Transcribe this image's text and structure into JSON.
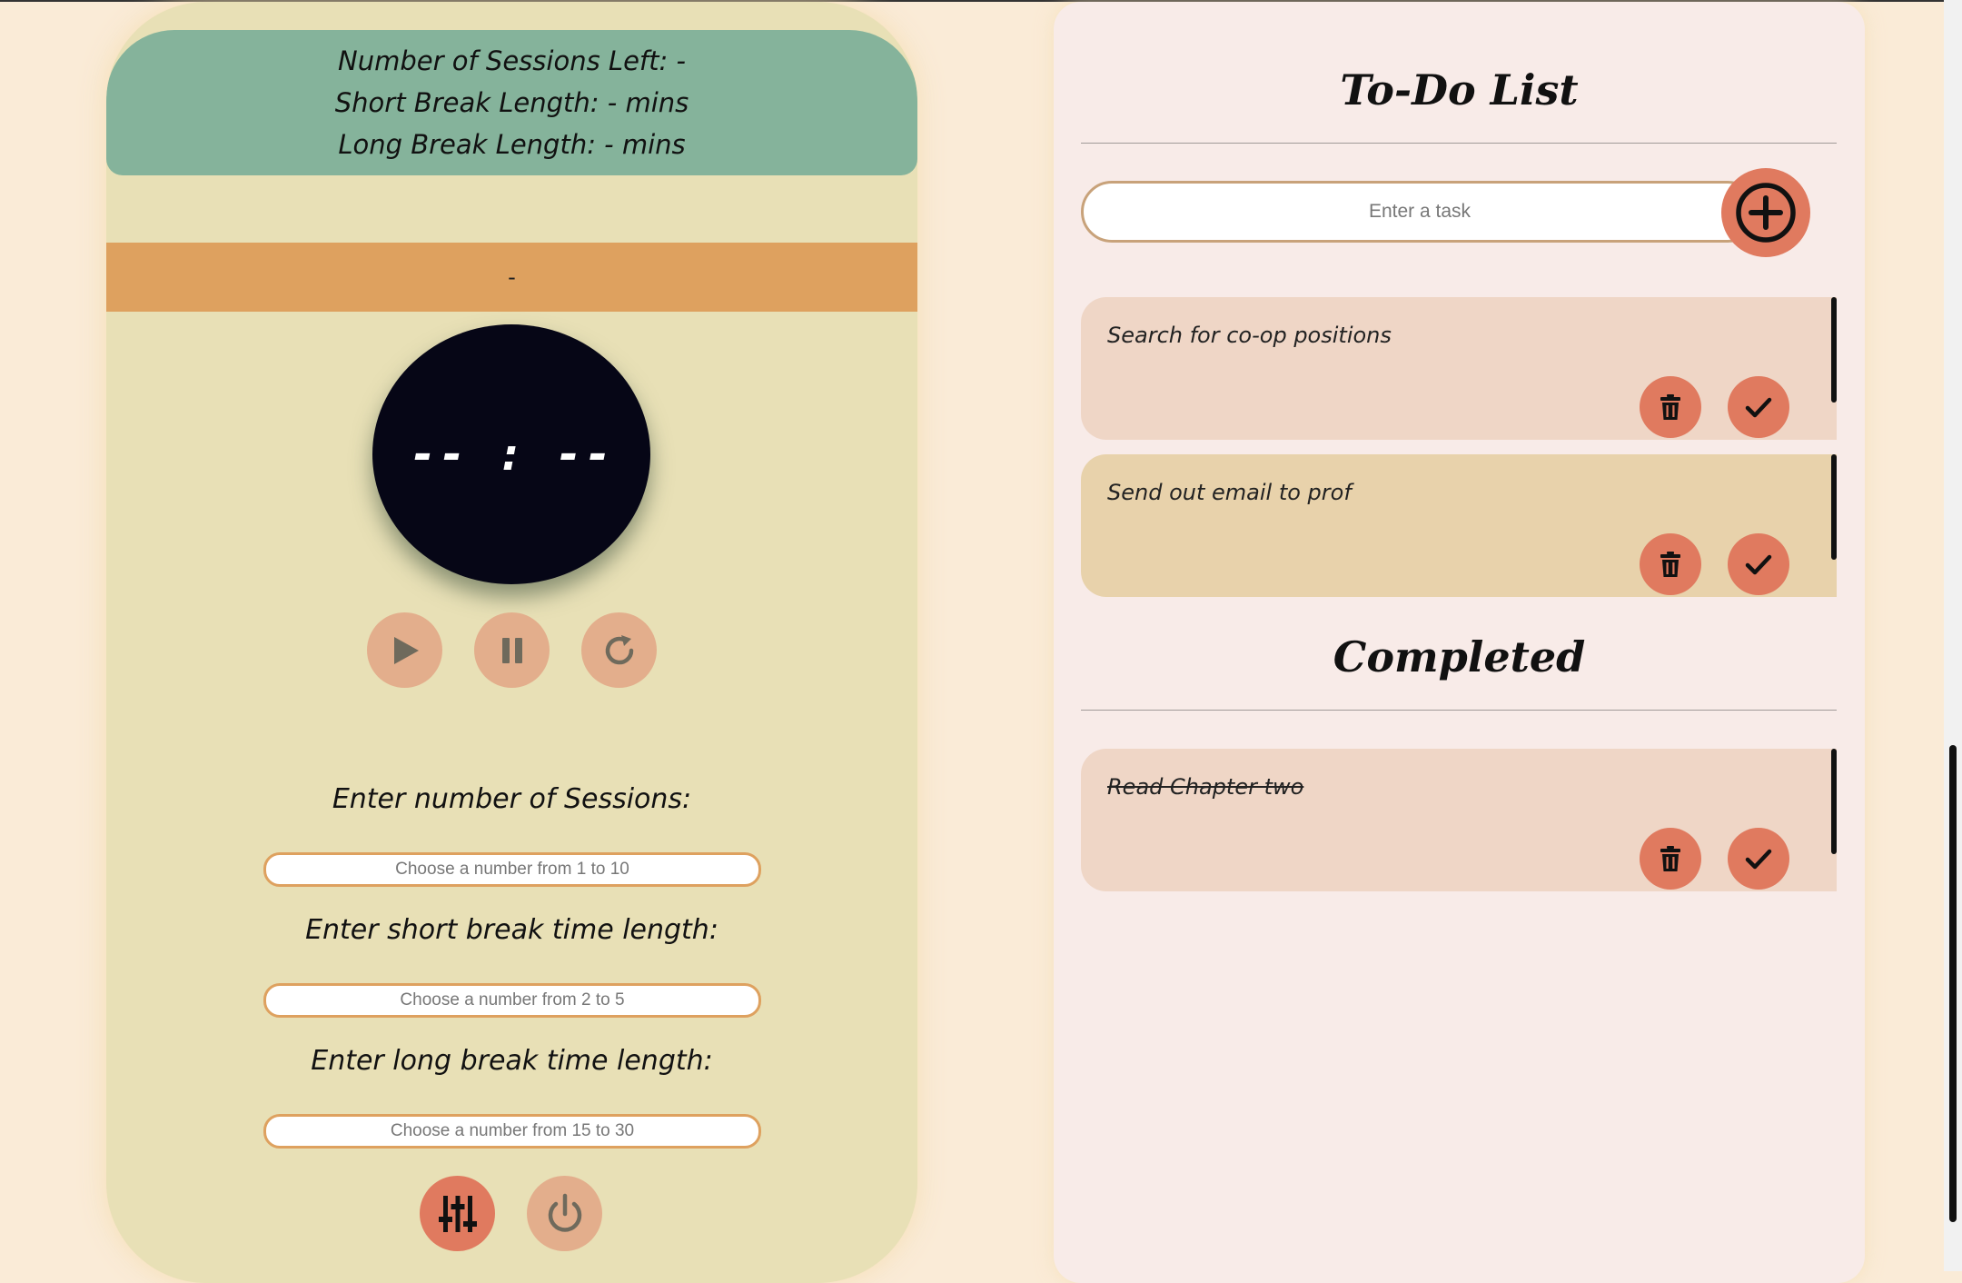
{
  "pomodoro": {
    "info": {
      "sessions_left": "Number of Sessions Left: -",
      "short_break": "Short Break Length: - mins",
      "long_break": "Long Break Length: - mins"
    },
    "status": "-",
    "timer": "-- : --",
    "controls": {
      "play_icon": "play-icon",
      "pause_icon": "pause-icon",
      "reset_icon": "reset-icon"
    },
    "settings": {
      "sessions_label": "Enter number of Sessions:",
      "sessions_placeholder": "Choose a number from 1 to 10",
      "short_label": "Enter short break time length:",
      "short_placeholder": "Choose a number from 2 to 5",
      "long_label": "Enter long break time length:",
      "long_placeholder": "Choose a number from 15 to 30"
    },
    "bottom_buttons": {
      "settings_icon": "sliders-icon",
      "power_icon": "power-icon"
    }
  },
  "todo": {
    "title": "To-Do List",
    "input_placeholder": "Enter a task",
    "add_icon": "plus-circle-icon",
    "tasks": [
      {
        "text": "Search for co-op positions"
      },
      {
        "text": "Send out email to prof"
      }
    ],
    "completed_title": "Completed",
    "completed": [
      {
        "text": "Read Chapter two"
      }
    ]
  },
  "colors": {
    "page_bg": "#faebd7",
    "pomodoro_panel": "#e8e0b6",
    "info_card": "#85b39b",
    "status_bar": "#dea15f",
    "timer_bg": "#060616",
    "control_btn": "#e3ae8c",
    "accent_btn": "#e07a5f",
    "todo_panel": "#f8ebe8",
    "task_card_1": "#efd6c6",
    "task_card_2": "#e8d2ab"
  }
}
